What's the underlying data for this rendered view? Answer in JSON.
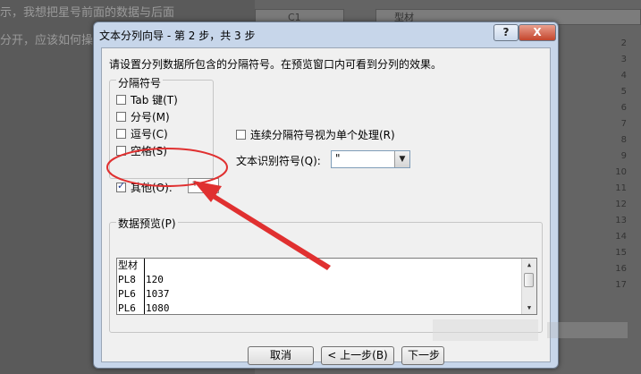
{
  "background": {
    "article_lines": [
      "示，我想把星号前面的数据与后面",
      "分开，应该如何操"
    ],
    "name_box": "C1",
    "formula_value": "型材",
    "row_numbers": [
      "2",
      "3",
      "4",
      "5",
      "6",
      "7",
      "8",
      "9",
      "10",
      "11",
      "12",
      "13",
      "14",
      "15",
      "16",
      "17"
    ]
  },
  "dialog": {
    "title": "文本分列向导 - 第 2 步，共 3 步",
    "help_label": "?",
    "close_label": "X",
    "instruction": "请设置分列数据所包含的分隔符号。在预览窗口内可看到分列的效果。",
    "delimiters": {
      "group_label": "分隔符号",
      "options": [
        {
          "label": "Tab 键(T)",
          "checked": false
        },
        {
          "label": "分号(M)",
          "checked": false
        },
        {
          "label": "逗号(C)",
          "checked": false
        },
        {
          "label": "空格(S)",
          "checked": false
        },
        {
          "label": "其他(O):",
          "checked": true
        }
      ],
      "other_value": "*"
    },
    "consecutive_label": "连续分隔符号视为单个处理(R)",
    "qualifier": {
      "label": "文本识别符号(Q):",
      "value": "\""
    },
    "preview": {
      "label": "数据预览(P)",
      "rows": [
        [
          "型材",
          ""
        ],
        [
          "PL8",
          "120"
        ],
        [
          "PL6",
          "1037"
        ],
        [
          "PL6",
          "1080"
        ]
      ]
    },
    "buttons": {
      "cancel": "取消",
      "back": "< 上一步(B)",
      "next": "下一步"
    }
  },
  "annotation_color": "#e03030"
}
